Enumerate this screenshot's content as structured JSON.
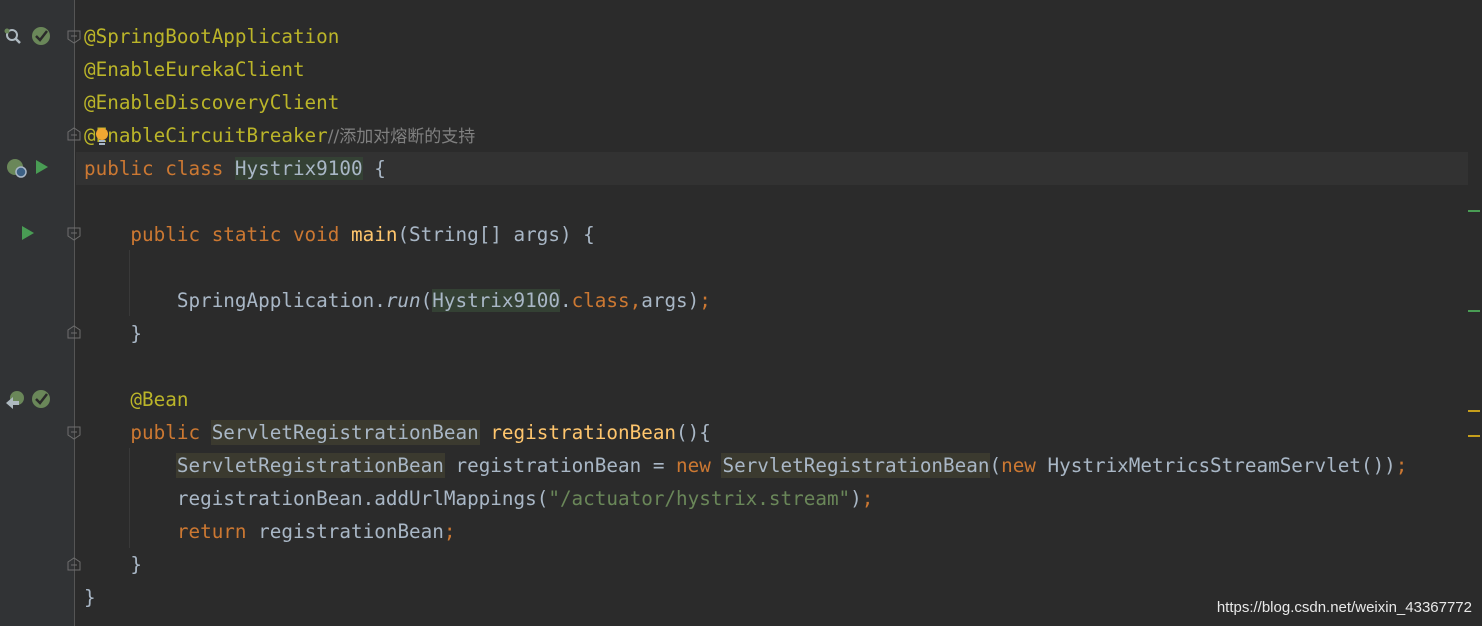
{
  "editor": {
    "lines": [
      {
        "tokens": [
          {
            "t": "@SpringBootApplication",
            "c": "ann"
          }
        ]
      },
      {
        "tokens": [
          {
            "t": "@EnableEurekaClient",
            "c": "ann"
          }
        ]
      },
      {
        "tokens": [
          {
            "t": "@EnableDiscoveryClient",
            "c": "ann"
          }
        ]
      },
      {
        "tokens": [
          {
            "t": "@EnableCircuitBreaker",
            "c": "ann"
          },
          {
            "t": "//添加对熔断的支持",
            "c": "cmt"
          }
        ]
      },
      {
        "current": true,
        "tokens": [
          {
            "t": "public class ",
            "c": "kw"
          },
          {
            "t": "Hystrix9100",
            "c": "hl-cls"
          },
          {
            "t": " {",
            "c": ""
          }
        ]
      },
      {
        "tokens": []
      },
      {
        "tokens": [
          {
            "t": "    public static void ",
            "c": "kw"
          },
          {
            "t": "main",
            "c": "fn"
          },
          {
            "t": "(String[] args) {",
            "c": ""
          }
        ]
      },
      {
        "tokens": []
      },
      {
        "tokens": [
          {
            "t": "        SpringApplication.",
            "c": ""
          },
          {
            "t": "run",
            "c": "it"
          },
          {
            "t": "(",
            "c": ""
          },
          {
            "t": "Hystrix9100",
            "c": "hl-cls"
          },
          {
            "t": ".",
            "c": ""
          },
          {
            "t": "class",
            "c": "kw"
          },
          {
            "t": ",",
            "c": "kw"
          },
          {
            "t": "args)",
            "c": ""
          },
          {
            "t": ";",
            "c": "kw"
          }
        ]
      },
      {
        "tokens": [
          {
            "t": "    }",
            "c": ""
          }
        ]
      },
      {
        "tokens": []
      },
      {
        "tokens": [
          {
            "t": "    @Bean",
            "c": "ann"
          }
        ]
      },
      {
        "tokens": [
          {
            "t": "    public ",
            "c": "kw"
          },
          {
            "t": "ServletRegistrationBean",
            "c": "hl-type"
          },
          {
            "t": " ",
            "c": ""
          },
          {
            "t": "registrationBean",
            "c": "fn"
          },
          {
            "t": "(){",
            "c": ""
          }
        ]
      },
      {
        "tokens": [
          {
            "t": "        ",
            "c": ""
          },
          {
            "t": "ServletRegistrationBean",
            "c": "hl-type"
          },
          {
            "t": " registrationBean = ",
            "c": ""
          },
          {
            "t": "new ",
            "c": "kw"
          },
          {
            "t": "ServletRegistrationBean",
            "c": "hl-type"
          },
          {
            "t": "(",
            "c": ""
          },
          {
            "t": "new ",
            "c": "kw"
          },
          {
            "t": "HystrixMetricsStreamServlet())",
            "c": ""
          },
          {
            "t": ";",
            "c": "kw"
          }
        ]
      },
      {
        "tokens": [
          {
            "t": "        registrationBean.addUrlMappings(",
            "c": ""
          },
          {
            "t": "\"/actuator/hystrix.stream\"",
            "c": "str"
          },
          {
            "t": ")",
            "c": ""
          },
          {
            "t": ";",
            "c": "kw"
          }
        ]
      },
      {
        "tokens": [
          {
            "t": "        ",
            "c": ""
          },
          {
            "t": "return ",
            "c": "kw"
          },
          {
            "t": "registrationBean",
            "c": ""
          },
          {
            "t": ";",
            "c": "kw"
          }
        ]
      },
      {
        "tokens": [
          {
            "t": "    }",
            "c": ""
          }
        ]
      },
      {
        "tokens": [
          {
            "t": "}",
            "c": ""
          }
        ]
      }
    ]
  },
  "gutter_icons": [
    {
      "name": "find-usages-icon",
      "line": 0
    },
    {
      "name": "spring-bean-icon",
      "line": 0
    },
    {
      "name": "spring-app-icon",
      "line": 4
    },
    {
      "name": "run-class-icon",
      "line": 4
    },
    {
      "name": "run-main-icon",
      "line": 6
    },
    {
      "name": "navigate-bean-icon",
      "line": 11
    },
    {
      "name": "spring-bean-icon",
      "line": 11
    }
  ],
  "watermark": "https://blog.csdn.net/weixin_43367772",
  "colors": {
    "background": "#2b2b2b",
    "gutter": "#313335",
    "annotation": "#bbb529",
    "keyword": "#cc7832",
    "method": "#ffc66d",
    "string": "#6a8759",
    "comment": "#808080",
    "text": "#a9b7c6",
    "run_green": "#499c54"
  }
}
